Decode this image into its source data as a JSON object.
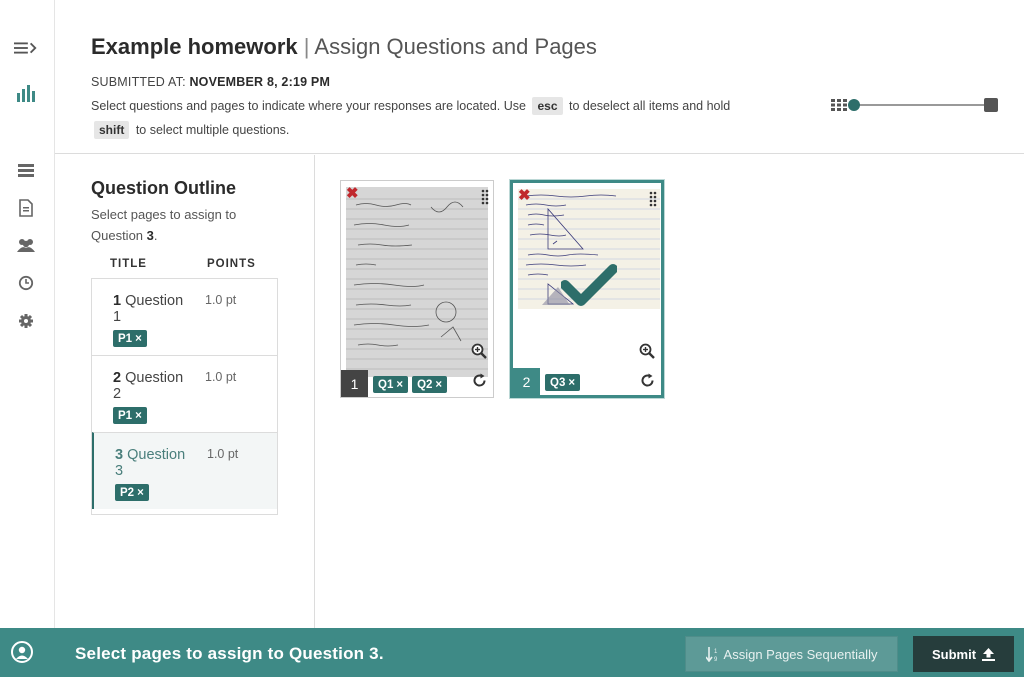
{
  "header": {
    "assignment": "Example homework",
    "separator": "|",
    "subtitle": "Assign Questions and Pages",
    "submitted_label": "SUBMITTED AT:",
    "submitted_value": "NOVEMBER 8, 2:19 PM",
    "instr_1": "Select questions and pages to indicate where your responses are located. Use",
    "key_esc": "esc",
    "instr_2": "to deselect all items and hold",
    "key_shift": "shift",
    "instr_3": "to select multiple questions."
  },
  "zoom": {
    "level": 0.0
  },
  "outline": {
    "title": "Question Outline",
    "hint_prefix": "Select pages to assign to Question",
    "hint_question": "3",
    "hint_suffix": ".",
    "col_title": "TITLE",
    "col_points": "POINTS",
    "questions": [
      {
        "num": "1",
        "label": "Question 1",
        "points": "1.0 pt",
        "tag": "P1"
      },
      {
        "num": "2",
        "label": "Question 2",
        "points": "1.0 pt",
        "tag": "P1"
      },
      {
        "num": "3",
        "label": "Question 3",
        "points": "1.0 pt",
        "tag": "P2"
      }
    ]
  },
  "pages": [
    {
      "num": "1",
      "tags": [
        "Q1",
        "Q2"
      ],
      "selected": false
    },
    {
      "num": "2",
      "tags": [
        "Q3"
      ],
      "selected": true
    }
  ],
  "tag_remove": "×",
  "footer": {
    "message": "Select pages to assign to Question 3.",
    "seq_button": "Assign Pages Sequentially",
    "submit_button": "Submit"
  },
  "colors": {
    "accent": "#3e8a86",
    "tag": "#2d6e6a",
    "submit": "#263d3c",
    "remove": "#c0282d"
  },
  "icons": [
    "menu-expand-icon",
    "stats-icon",
    "outline-icon",
    "document-icon",
    "users-icon",
    "clock-icon",
    "gear-icon",
    "grid-icon",
    "zoom-in-icon",
    "rotate-icon",
    "drag-icon",
    "remove-icon",
    "check-icon",
    "avatar-icon",
    "sort-icon",
    "upload-icon"
  ]
}
